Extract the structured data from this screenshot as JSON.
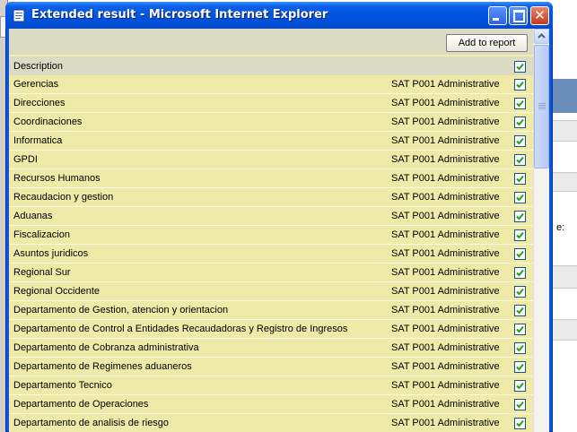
{
  "window": {
    "title": "Extended result - Microsoft Internet Explorer"
  },
  "toolbar": {
    "add_to_report_label": "Add to report"
  },
  "table": {
    "header_label": "Description",
    "header_checked": true,
    "rows": [
      {
        "label": "Gerencias",
        "code": "SAT P001 Administrative",
        "checked": true
      },
      {
        "label": "Direcciones",
        "code": "SAT P001 Administrative",
        "checked": true
      },
      {
        "label": "Coordinaciones",
        "code": "SAT P001 Administrative",
        "checked": true
      },
      {
        "label": "Informatica",
        "code": "SAT P001 Administrative",
        "checked": true
      },
      {
        "label": "GPDI",
        "code": "SAT P001 Administrative",
        "checked": true
      },
      {
        "label": "Recursos Humanos",
        "code": "SAT P001 Administrative",
        "checked": true
      },
      {
        "label": "Recaudacion y gestion",
        "code": "SAT P001 Administrative",
        "checked": true
      },
      {
        "label": "Aduanas",
        "code": "SAT P001 Administrative",
        "checked": true
      },
      {
        "label": "Fiscalizacion",
        "code": "SAT P001 Administrative",
        "checked": true
      },
      {
        "label": "Asuntos juridicos",
        "code": "SAT P001 Administrative",
        "checked": true
      },
      {
        "label": "Regional Sur",
        "code": "SAT P001 Administrative",
        "checked": true
      },
      {
        "label": "Regional Occidente",
        "code": "SAT P001 Administrative",
        "checked": true
      },
      {
        "label": "Departamento de Gestion, atencion y orientacion",
        "code": "SAT P001 Administrative",
        "checked": true
      },
      {
        "label": "Departamento de Control a Entidades Recaudadoras y Registro de Ingresos",
        "code": "SAT P001 Administrative",
        "checked": true
      },
      {
        "label": "Departamento de Cobranza administrativa",
        "code": "SAT P001 Administrative",
        "checked": true
      },
      {
        "label": "Departamento de Regimenes aduaneros",
        "code": "SAT P001 Administrative",
        "checked": true
      },
      {
        "label": "Departamento Tecnico",
        "code": "SAT P001 Administrative",
        "checked": true
      },
      {
        "label": "Departamento de Operaciones",
        "code": "SAT P001 Administrative",
        "checked": true
      },
      {
        "label": "Departamento de analisis de riesgo",
        "code": "SAT P001 Administrative",
        "checked": true
      }
    ]
  },
  "background": {
    "right_snippet": "e:"
  },
  "colors": {
    "titlebar": "#0054e3",
    "row_bg": "#f0eaa8",
    "header_bg": "#dcdcc4",
    "checkbox_check": "#21a121"
  },
  "icons": {
    "title_icon": "ie-page-icon",
    "checkbox": "checkbox-checked-icon",
    "scroll_up": "scroll-up-arrow-icon"
  }
}
